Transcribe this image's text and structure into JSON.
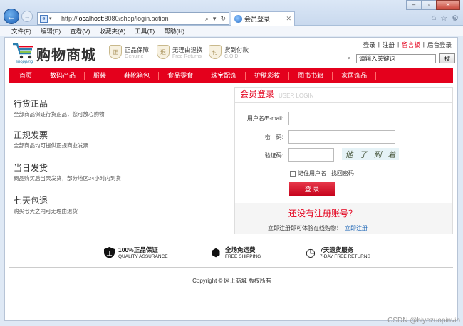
{
  "browser": {
    "url_prefix": "http://",
    "url_host": "localhost",
    "url_rest": ":8080/shop/login.action",
    "addr_tools": [
      "⌕",
      "▾",
      "↻"
    ],
    "tab_title": "会员登录",
    "tab_close": "✕",
    "back_glyph": "←",
    "forward_glyph": "→",
    "window_buttons": [
      "–",
      "▫",
      "✕"
    ],
    "right_icons": [
      "⌂",
      "☆",
      "⚙"
    ],
    "menu": [
      "文件(F)",
      "编辑(E)",
      "查看(V)",
      "收藏夹(A)",
      "工具(T)",
      "帮助(H)"
    ]
  },
  "header": {
    "logo_text": "购物商城",
    "logo_sub": "shopping",
    "badges": [
      {
        "title": "正品保障",
        "sub": "Genuine",
        "icon": "正"
      },
      {
        "title": "无理由退换",
        "sub": "Free Returns",
        "icon": "退"
      },
      {
        "title": "货到付款",
        "sub": "C.O.D",
        "icon": "付"
      }
    ],
    "top_links": [
      "登录",
      "|",
      "注册",
      "|",
      "留言板",
      "|",
      "后台登录"
    ],
    "search_value": "请输入关键词",
    "search_button": "搜"
  },
  "nav": [
    "首页",
    "数码产品",
    "服装",
    "鞋靴箱包",
    "食品零食",
    "珠宝配饰",
    "护肤彩妆",
    "图书书籍",
    "家居饰品"
  ],
  "features": [
    {
      "title": "行货正品",
      "desc": "全部商品保证行货正品，您可放心购物"
    },
    {
      "title": "正规发票",
      "desc": "全部商品均可提供正规商业发票"
    },
    {
      "title": "当日发货",
      "desc": "商品购买后当天发货，部分地区24小时内到货"
    },
    {
      "title": "七天包退",
      "desc": "购买七天之内可无理由退货"
    }
  ],
  "login": {
    "title": "会员登录",
    "subtitle": "USER LOGIN",
    "username_label": "用户名/E-mail:",
    "password_label": "密　码:",
    "captcha_label": "验证码:",
    "captcha_chars": [
      "他",
      "了",
      "到",
      "着"
    ],
    "remember_label": "记住用户名",
    "forgot_label": "找回密码",
    "submit_label": "登 录",
    "register_title": "还没有注册账号？",
    "register_desc": "立即注册即可体验在线购物！",
    "register_link": "立即注册"
  },
  "services": [
    {
      "title": "100%正品保证",
      "sub": "QUALITY ASSURANCE",
      "icon": "正"
    },
    {
      "title": "全场免运费",
      "sub": "FREE SHIPPING",
      "icon": "⬢"
    },
    {
      "title": "7天退货服务",
      "sub": "7-DAY FREE RETURNS",
      "icon": "◷"
    }
  ],
  "footer": {
    "copyright": "Copyright © 网上商城 版权所有",
    "watermark": "CSDN @biyezuopinvip"
  }
}
